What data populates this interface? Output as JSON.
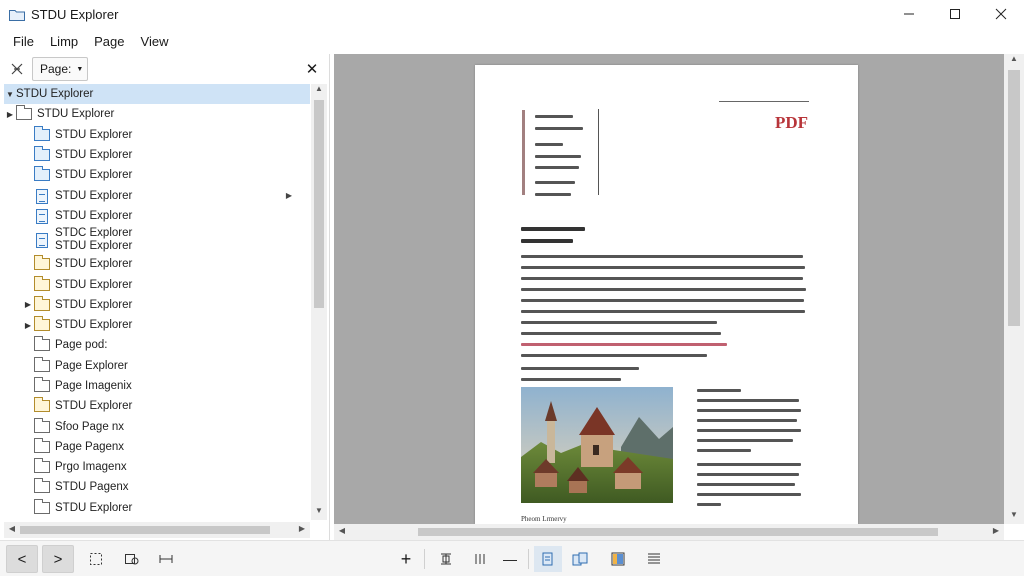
{
  "window": {
    "title": "STDU Explorer",
    "minimize_glyph": "—",
    "maximize_glyph": "☐",
    "close_glyph": "✕"
  },
  "menu": [
    "File",
    "Limp",
    "Page",
    "View"
  ],
  "panel": {
    "select_value": "Page:",
    "close_glyph": "✕"
  },
  "tree": [
    {
      "label": "STDU Explorer",
      "icon": "none",
      "arrow": "down",
      "selected": true,
      "indent": 0
    },
    {
      "label": "STDU Explorer",
      "icon": "folder-icon",
      "arrow": "right",
      "indent": 0
    },
    {
      "label": "STDU Explorer",
      "icon": "blue-folder-icon",
      "arrow": "",
      "indent": 1
    },
    {
      "label": "STDU Explorer",
      "icon": "blue-folder-icon",
      "arrow": "",
      "indent": 1
    },
    {
      "label": "STDU Explorer",
      "icon": "blue-folder-icon",
      "arrow": "",
      "indent": 1
    },
    {
      "label": "STDU Explorer",
      "icon": "document-icon",
      "arrow": "",
      "indent": 1,
      "right_arrow": true
    },
    {
      "label": "STDU Explorer",
      "icon": "document-icon",
      "arrow": "",
      "indent": 1
    },
    {
      "label": "STDC Explorer",
      "label2": "STDU Explorer",
      "icon": "document-icon",
      "arrow": "",
      "indent": 1,
      "double": true
    },
    {
      "label": "STDU Explorer",
      "icon": "yellow-folder-icon",
      "arrow": "",
      "indent": 1
    },
    {
      "label": "STDU Explorer",
      "icon": "yellow-folder-icon",
      "arrow": "",
      "indent": 1
    },
    {
      "label": "STDU Explorer",
      "icon": "yellow-folder-icon",
      "arrow": "right",
      "indent": 1
    },
    {
      "label": "STDU Explorer",
      "icon": "yellow-folder-icon",
      "arrow": "right",
      "indent": 1
    },
    {
      "label": "Page pod:",
      "icon": "folder-icon",
      "arrow": "",
      "indent": 1
    },
    {
      "label": "Page Explorer",
      "icon": "folder-icon",
      "arrow": "",
      "indent": 1
    },
    {
      "label": "Page Imagenix",
      "icon": "folder-icon",
      "arrow": "",
      "indent": 1
    },
    {
      "label": "STDU Explorer",
      "icon": "yellow-folder-icon",
      "arrow": "",
      "indent": 1
    },
    {
      "label": "Sfoo Page nx",
      "icon": "folder-icon",
      "arrow": "",
      "indent": 1
    },
    {
      "label": "Page Pagenx",
      "icon": "folder-icon",
      "arrow": "",
      "indent": 1
    },
    {
      "label": "Prgo Imagenx",
      "icon": "folder-icon",
      "arrow": "",
      "indent": 1
    },
    {
      "label": "STDU Pagenx",
      "icon": "folder-icon",
      "arrow": "",
      "indent": 1
    },
    {
      "label": "STDU Explorer",
      "icon": "folder-icon",
      "arrow": "",
      "indent": 1
    }
  ],
  "document": {
    "pdf_label": "PDF",
    "caption": "Pheom Lrmervy"
  },
  "colors": {
    "accent_red": "#b8353a",
    "selection": "#cfe3f6",
    "canvas_gray": "#a8a8a8"
  },
  "bottom_toolbar": {
    "prev_glyph": "<",
    "next_glyph": ">",
    "zoom_in_glyph": "+",
    "zoom_out_glyph": "—"
  }
}
